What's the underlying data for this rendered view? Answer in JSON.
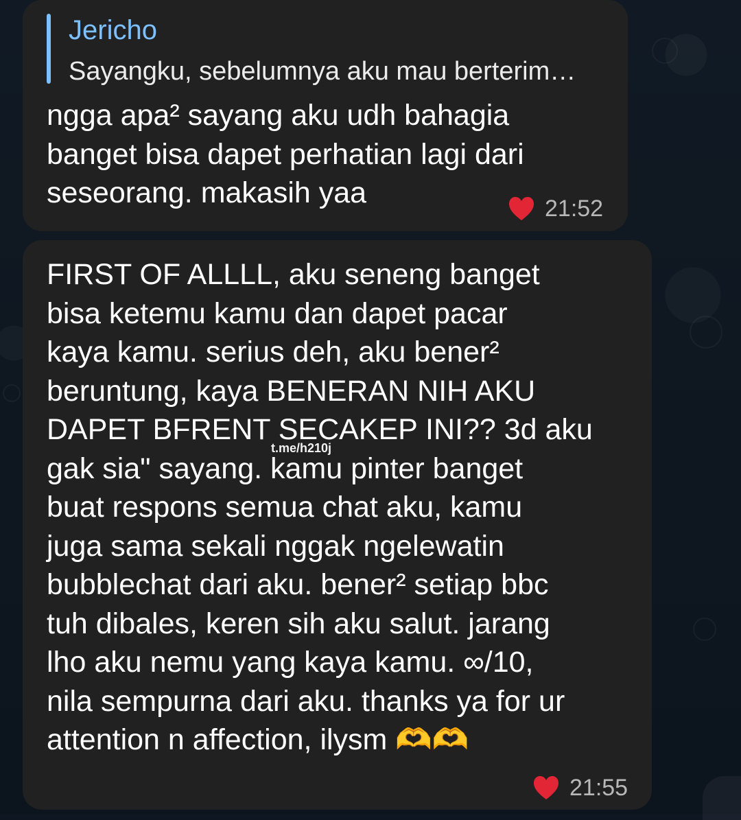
{
  "messages": [
    {
      "reply": {
        "author": "Jericho",
        "text": "Sayangku, sebelumnya aku mau berterim…"
      },
      "text": "ngga apa² sayang aku udh bahagia\nbanget bisa dapet perhatian lagi dari\nseseorang. makasih yaa",
      "reaction": "heart",
      "time": "21:52"
    },
    {
      "text": "FIRST OF ALLLL, aku seneng banget\nbisa ketemu kamu dan dapet pacar\nkaya kamu. serius deh, aku bener²\nberuntung, kaya BENERAN NIH AKU\nDAPET BFRENT SECAKEP INI?? 3d aku\ngak sia\" sayang. kamu pinter banget\nbuat respons semua chat aku, kamu\njuga sama sekali nggak ngelewatin\nbubblechat dari aku. bener² setiap bbc\ntuh dibales, keren sih aku salut. jarang\nlho aku nemu yang kaya kamu. ∞/10,\nnila sempurna dari aku. thanks ya for ur\nattention n affection, ilysm 🫶🫶",
      "reaction": "heart",
      "time": "21:55"
    }
  ],
  "watermark": "t.me/h210j",
  "colors": {
    "background": "#0e1621",
    "bubble": "#212121",
    "reply_accent": "#7cc0ff",
    "heart": "#e32636",
    "meta_text": "#b8b8b8"
  }
}
